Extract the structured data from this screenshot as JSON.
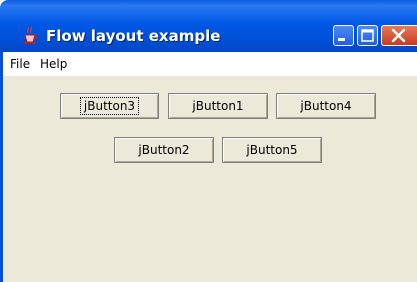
{
  "window": {
    "title": "Flow layout example",
    "icon": "java-cup-icon",
    "title_buttons": [
      "minimize-icon",
      "maximize-icon",
      "close-icon"
    ],
    "colors": {
      "titlebar": "#0058e6",
      "content_background": "#ece9d8",
      "close_button": "#c63c1d"
    }
  },
  "menubar": {
    "items": [
      {
        "label": "File"
      },
      {
        "label": "Help"
      }
    ]
  },
  "content": {
    "buttons": [
      {
        "label": "jButton3",
        "focused": true
      },
      {
        "label": "jButton1",
        "focused": false
      },
      {
        "label": "jButton4",
        "focused": false
      },
      {
        "label": "jButton2",
        "focused": false
      },
      {
        "label": "jButton5",
        "focused": false
      }
    ]
  }
}
